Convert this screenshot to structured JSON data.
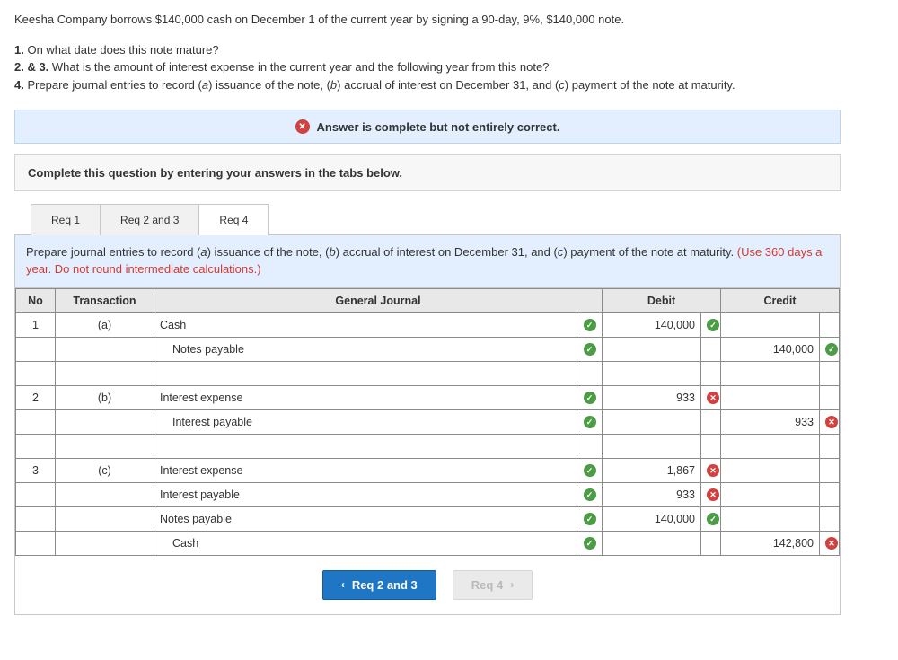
{
  "problem": {
    "intro": "Keesha Company borrows $140,000 cash on December 1 of the current year by signing a 90-day, 9%, $140,000 note.",
    "q1_label": "1.",
    "q1": " On what date does this note mature?",
    "q23_label": "2. & 3.",
    "q23": " What is the amount of interest expense in the current year and the following year from this note?",
    "q4_label": "4.",
    "q4_a": " Prepare journal entries to record (",
    "q4_a_i": "a",
    "q4_b": ") issuance of the note, (",
    "q4_b_i": "b",
    "q4_c": ") accrual of interest on December 31, and (",
    "q4_c_i": "c",
    "q4_d": ") payment of the note at maturity."
  },
  "status": {
    "text": "Answer is complete but not entirely correct."
  },
  "instruction": "Complete this question by entering your answers in the tabs below.",
  "tabs": [
    {
      "label": "Req 1"
    },
    {
      "label": "Req 2 and 3"
    },
    {
      "label": "Req 4"
    }
  ],
  "tab_instructions": {
    "line1_a": "Prepare journal entries to record (",
    "line1_i1": "a",
    "line1_b": ") issuance of the note, (",
    "line1_i2": "b",
    "line1_c": ") accrual of interest on December 31, and (",
    "line1_i3": "c",
    "line1_d": ") payment of the note at maturity. ",
    "red": "(Use 360 days a year. Do not round intermediate calculations.)"
  },
  "table": {
    "headers": {
      "no": "No",
      "trans": "Transaction",
      "journal": "General Journal",
      "debit": "Debit",
      "credit": "Credit"
    },
    "rows": [
      {
        "no": "1",
        "trans": "(a)",
        "account": "Cash",
        "indent": 0,
        "mark": "ok",
        "debit": "140,000",
        "dmark": "ok",
        "credit": "",
        "cmark": ""
      },
      {
        "no": "",
        "trans": "",
        "account": "Notes payable",
        "indent": 1,
        "mark": "ok",
        "debit": "",
        "dmark": "",
        "credit": "140,000",
        "cmark": "ok"
      },
      {
        "no": "",
        "trans": "",
        "account": "",
        "indent": 0,
        "mark": "",
        "debit": "",
        "dmark": "",
        "credit": "",
        "cmark": ""
      },
      {
        "no": "2",
        "trans": "(b)",
        "account": "Interest expense",
        "indent": 0,
        "mark": "ok",
        "debit": "933",
        "dmark": "bad",
        "credit": "",
        "cmark": ""
      },
      {
        "no": "",
        "trans": "",
        "account": "Interest payable",
        "indent": 1,
        "mark": "ok",
        "debit": "",
        "dmark": "",
        "credit": "933",
        "cmark": "bad"
      },
      {
        "no": "",
        "trans": "",
        "account": "",
        "indent": 0,
        "mark": "",
        "debit": "",
        "dmark": "",
        "credit": "",
        "cmark": ""
      },
      {
        "no": "3",
        "trans": "(c)",
        "account": "Interest expense",
        "indent": 0,
        "mark": "ok",
        "debit": "1,867",
        "dmark": "bad",
        "credit": "",
        "cmark": ""
      },
      {
        "no": "",
        "trans": "",
        "account": "Interest payable",
        "indent": 0,
        "mark": "ok",
        "debit": "933",
        "dmark": "bad",
        "credit": "",
        "cmark": ""
      },
      {
        "no": "",
        "trans": "",
        "account": "Notes payable",
        "indent": 0,
        "mark": "ok",
        "debit": "140,000",
        "dmark": "ok",
        "credit": "",
        "cmark": ""
      },
      {
        "no": "",
        "trans": "",
        "account": "Cash",
        "indent": 1,
        "mark": "ok",
        "debit": "",
        "dmark": "",
        "credit": "142,800",
        "cmark": "bad"
      }
    ]
  },
  "nav": {
    "prev": "Req 2 and 3",
    "next": "Req 4"
  }
}
